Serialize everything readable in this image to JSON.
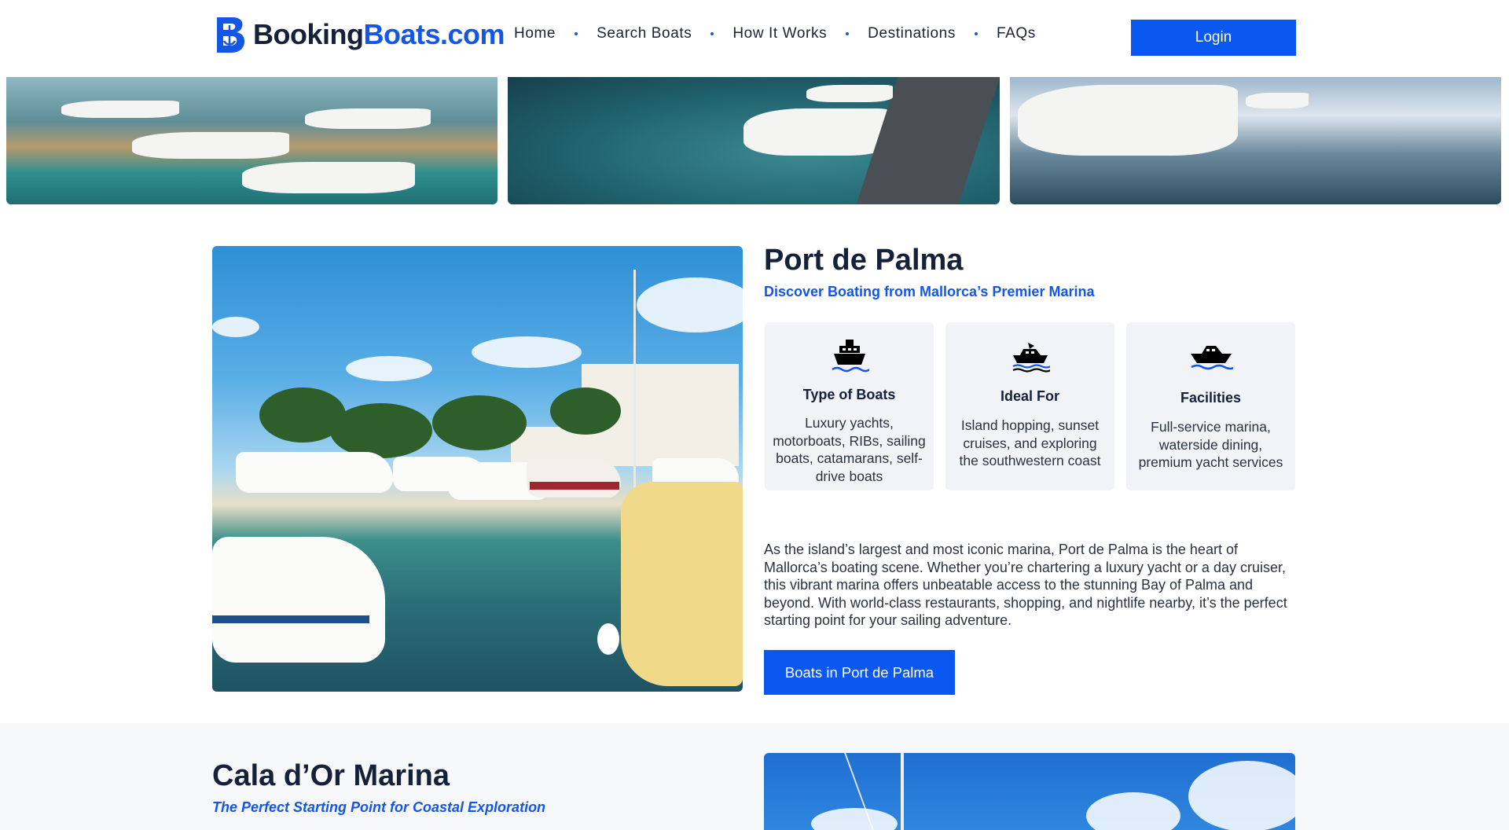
{
  "header": {
    "logo_part1": "Booking",
    "logo_part2": "Boats.com",
    "nav": [
      "Home",
      "Search Boats",
      "How It Works",
      "Destinations",
      "FAQs"
    ],
    "login_label": "Login"
  },
  "colors": {
    "brand_blue": "#0b57f2",
    "accent_blue": "#1456e6",
    "heading": "#15213a",
    "card_bg": "#f1f3f7"
  },
  "marina1": {
    "title": "Port de Palma",
    "subtitle": "Discover Boating from Mallorca’s Premier Marina",
    "cards": [
      {
        "icon": "cruise-ship-icon",
        "title": "Type of Boats",
        "text": "Luxury yachts, motorboats, RIBs, sailing boats, catamarans, self-drive boats"
      },
      {
        "icon": "speedboat-icon",
        "title": "Ideal For",
        "text": "Island hopping, sunset cruises, and exploring the southwestern coast"
      },
      {
        "icon": "yacht-icon",
        "title": "Facilities",
        "text": "Full-service marina, waterside dining, premium yacht services"
      }
    ],
    "description": "As the island’s largest and most iconic marina, Port de Palma is the heart of Mallorca’s boating scene. Whether you’re chartering a luxury yacht or a day cruiser, this vibrant marina offers unbeatable access to the stunning Bay of Palma and beyond. With world-class restaurants, shopping, and nightlife nearby, it’s the perfect starting point for your sailing adventure.",
    "button_label": "Boats in Port de Palma"
  },
  "marina2": {
    "title": "Cala d’Or Marina",
    "subtitle": "The Perfect Starting Point for Coastal Exploration"
  }
}
